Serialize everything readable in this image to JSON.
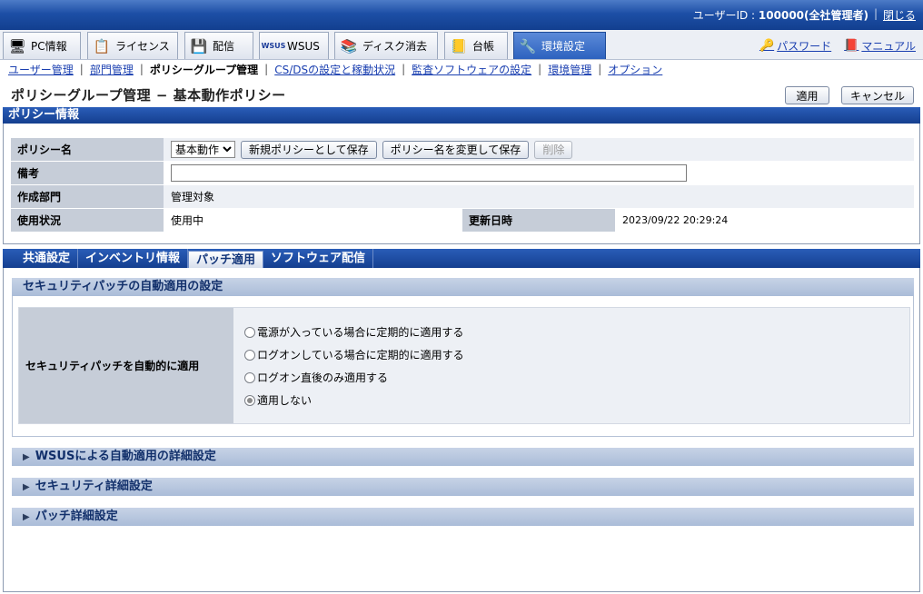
{
  "topbar": {
    "user_label": "ユーザーID : ",
    "user_value": "100000(全社管理者)",
    "close": "閉じる"
  },
  "main_tabs": [
    {
      "label": "PC情報",
      "icon": "pc-icon"
    },
    {
      "label": "ライセンス",
      "icon": "license-icon"
    },
    {
      "label": "配信",
      "icon": "delivery-icon"
    },
    {
      "label": "WSUS",
      "icon": "wsus-icon"
    },
    {
      "label": "ディスク消去",
      "icon": "disk-erase-icon"
    },
    {
      "label": "台帳",
      "icon": "ledger-icon"
    },
    {
      "label": "環境設定",
      "icon": "settings-icon",
      "active": true
    }
  ],
  "right_links": {
    "password": "パスワード",
    "manual": "マニュアル"
  },
  "sub_nav": {
    "items": [
      "ユーザー管理",
      "部門管理",
      "ポリシーグループ管理",
      "CS/DSの設定と稼動状況",
      "監査ソフトウェアの設定",
      "環境管理",
      "オプション"
    ],
    "current": "ポリシーグループ管理"
  },
  "page": {
    "title": "ポリシーグループ管理 − 基本動作ポリシー",
    "apply": "適用",
    "cancel": "キャンセル"
  },
  "policy_panel": {
    "header": "ポリシー情報",
    "name_label": "ポリシー名",
    "name_value": "基本動作",
    "save_new": "新規ポリシーとして保存",
    "save_rename": "ポリシー名を変更して保存",
    "delete": "削除",
    "note_label": "備考",
    "note_value": "",
    "dept_label": "作成部門",
    "dept_value": "管理対象",
    "status_label": "使用状況",
    "status_value": "使用中",
    "updated_label": "更新日時",
    "updated_value": "2023/09/22 20:29:24"
  },
  "sub_tabs": [
    {
      "label": "共通設定"
    },
    {
      "label": "インベントリ情報"
    },
    {
      "label": "パッチ適用",
      "active": true
    },
    {
      "label": "ソフトウェア配信"
    }
  ],
  "security_patch": {
    "header": "セキュリティパッチの自動適用の設定",
    "label": "セキュリティパッチを自動的に適用",
    "options": [
      "電源が入っている場合に定期的に適用する",
      "ログオンしている場合に定期的に適用する",
      "ログオン直後のみ適用する",
      "適用しない"
    ],
    "selected_index": 3
  },
  "collapsed_sections": [
    "WSUSによる自動適用の詳細設定",
    "セキュリティ詳細設定",
    "パッチ詳細設定"
  ],
  "colors": {
    "header_blue": "#1d4fa6",
    "link": "#1a3fb0",
    "label_gray": "#c6cdd8",
    "section_blue": "#aabcd8"
  }
}
